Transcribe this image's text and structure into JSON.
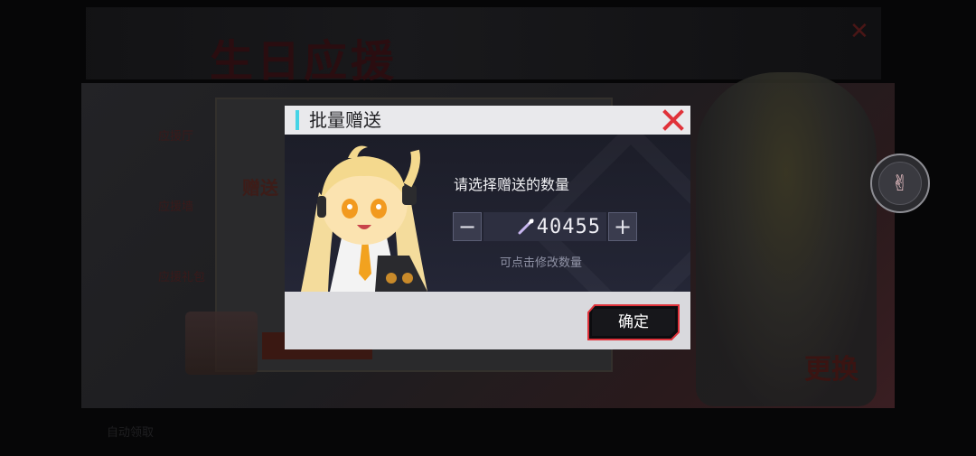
{
  "background": {
    "banner_title": "生日应援",
    "nav_items": [
      "应援厅",
      "应援墙",
      "应援礼包"
    ],
    "card_label": "赠送",
    "change_label": "更换",
    "footer_text": "自动领取"
  },
  "dialog": {
    "title": "批量赠送",
    "prompt": "请选择赠送的数量",
    "stepper": {
      "minus_label": "−",
      "plus_label": "+",
      "value": "40455"
    },
    "hint": "可点击修改数量",
    "confirm_label": "确定"
  },
  "icons": {
    "close": "close-icon",
    "item": "wand-item-icon",
    "gesture": "peace-hand-icon"
  },
  "colors": {
    "accent": "#46d4e6",
    "close": "#e0323a",
    "confirm_border": "#e0323a"
  }
}
